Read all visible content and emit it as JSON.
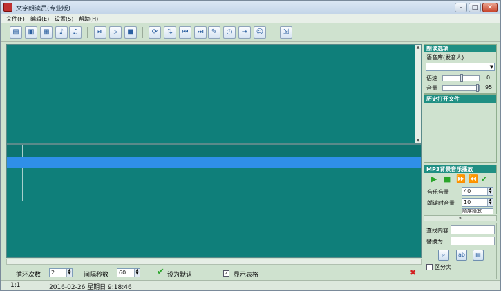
{
  "window": {
    "title": "文字朗读员(专业版)",
    "controls": {
      "minimize": "–",
      "maximize": "□",
      "close": "✕"
    }
  },
  "menu": [
    {
      "label": "文件(F)"
    },
    {
      "label": "编辑(E)"
    },
    {
      "label": "设置(S)"
    },
    {
      "label": "帮助(H)"
    }
  ],
  "toolbar": {
    "icons": [
      "new-file-icon",
      "open-folder-icon",
      "save-icon",
      "music-note-icon",
      "music-notes-icon",
      "step-forward-icon",
      "play-icon",
      "stop-icon",
      "refresh-icon",
      "loop-icon",
      "skip-back-icon",
      "skip-forward-icon",
      "edit-doc-icon",
      "timer-icon",
      "export-icon",
      "user-icon",
      "exit-icon"
    ],
    "glyphs": [
      "▤",
      "▣",
      "▦",
      "♪",
      "♫",
      "⏯",
      "▷",
      "■",
      "⟳",
      "⇅",
      "⏮",
      "⏭",
      "✎",
      "◷",
      "⇥",
      "☺",
      "⇲"
    ]
  },
  "options": {
    "loop_count_label": "循环次数",
    "loop_count_value": "2",
    "interval_label": "间隔秒数",
    "interval_value": "60",
    "set_default_label": "设为默认",
    "show_table_label": "显示表格",
    "show_table_checked": true
  },
  "status": {
    "position": "1:1",
    "datetime": "2016-02-26 星期日 9:18:46"
  },
  "panel_read": {
    "title": "朗读选项",
    "voice_label": "语音库(发音人):",
    "voice_value": "",
    "speed_label": "语速",
    "speed_value": "0",
    "volume_label": "音量",
    "volume_value": "95"
  },
  "panel_history": {
    "title": "历史打开文件"
  },
  "panel_mp3": {
    "title": "MP3背景音乐播放",
    "music_volume_label": "音乐音量",
    "music_volume_value": "40",
    "read_volume_label": "朗读时音量",
    "read_volume_value": "10",
    "mode_value": "顺序播放",
    "collapse_glyph": "«"
  },
  "panel_find": {
    "find_label": "查找内容",
    "replace_label": "替换为",
    "partial_label": "区分大"
  },
  "colors": {
    "editor_bg": "#0f7f7a",
    "selected_row": "#2f8fe8",
    "panel_header": "#1f8f83"
  }
}
